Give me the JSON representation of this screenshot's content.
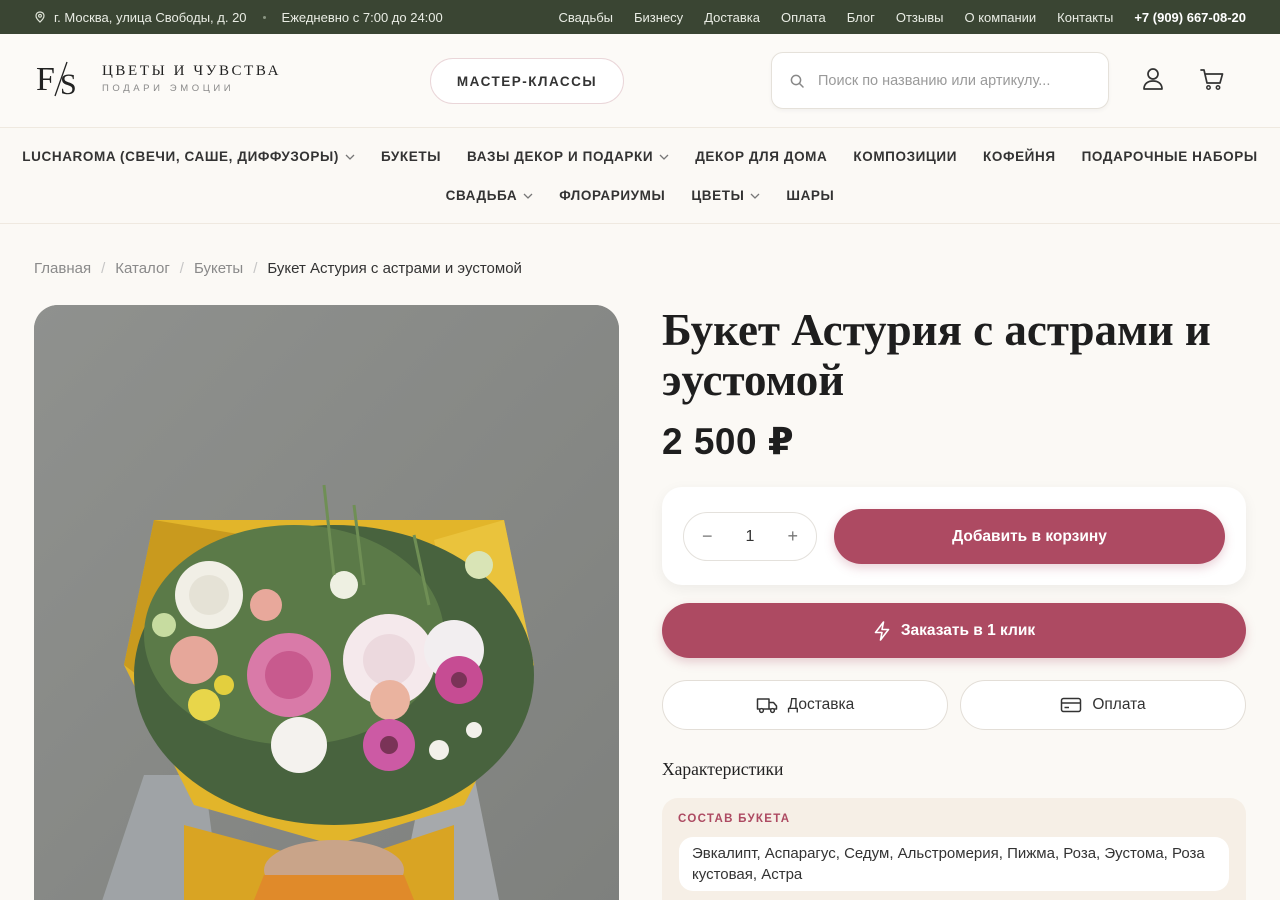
{
  "topbar": {
    "address": "г. Москва, улица Свободы, д. 20",
    "hours": "Ежедневно с 7:00 до 24:00",
    "nav": [
      "Свадьбы",
      "Бизнесу",
      "Доставка",
      "Оплата",
      "Блог",
      "Отзывы",
      "О компании",
      "Контакты"
    ],
    "phone": "+7 (909) 667-08-20"
  },
  "header": {
    "logo_mark": "F/S",
    "logo_title": "ЦВЕТЫ И ЧУВСТВА",
    "logo_subtitle": "ПОДАРИ ЭМОЦИИ",
    "masterclass_label": "МАСТЕР-КЛАССЫ",
    "search_placeholder": "Поиск по названию или артикулу..."
  },
  "catnav": {
    "row1": [
      {
        "label": "LUCHAROMA (СВЕЧИ, САШЕ, ДИФФУЗОРЫ)",
        "has_dropdown": true
      },
      {
        "label": "БУКЕТЫ",
        "has_dropdown": false
      },
      {
        "label": "ВАЗЫ ДЕКОР И ПОДАРКИ",
        "has_dropdown": true
      },
      {
        "label": "ДЕКОР ДЛЯ ДОМА",
        "has_dropdown": false
      },
      {
        "label": "КОМПОЗИЦИИ",
        "has_dropdown": false
      },
      {
        "label": "КОФЕЙНЯ",
        "has_dropdown": false
      },
      {
        "label": "ПОДАРОЧНЫЕ НАБОРЫ",
        "has_dropdown": false
      }
    ],
    "row2": [
      {
        "label": "СВАДЬБА",
        "has_dropdown": true
      },
      {
        "label": "ФЛОРАРИУМЫ",
        "has_dropdown": false
      },
      {
        "label": "ЦВЕТЫ",
        "has_dropdown": true
      },
      {
        "label": "ШАРЫ",
        "has_dropdown": false
      }
    ]
  },
  "breadcrumbs": [
    "Главная",
    "Каталог",
    "Букеты",
    "Букет Астурия с астрами и эустомой"
  ],
  "product": {
    "title": "Букет Астурия с астрами и эустомой",
    "price": "2 500 ₽",
    "quantity": "1",
    "add_to_cart_label": "Добавить в корзину",
    "one_click_label": "Заказать в 1 клик",
    "delivery_label": "Доставка",
    "payment_label": "Оплата",
    "characteristics_heading": "Характеристики",
    "composition_label": "СОСТАВ БУКЕТА",
    "composition_value": "Эвкалипт, Аспарагус, Седум, Альстромерия, Пижма, Роза, Эустома, Роза кустовая, Астра"
  },
  "colors": {
    "topbar_bg": "#3a4533",
    "accent": "#ad4a62",
    "page_bg": "#fbf9f5"
  }
}
